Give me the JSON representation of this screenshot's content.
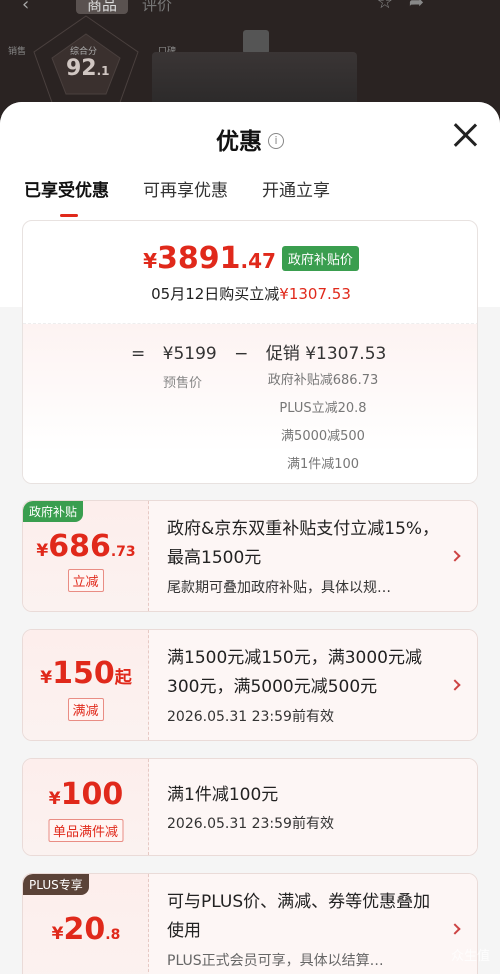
{
  "background": {
    "tab_active": "商品",
    "tab_next": "评价",
    "score_label": "综合分",
    "score_int": "92",
    "score_dec": ".1",
    "side_left": "销售",
    "side_right": "口碑"
  },
  "sheet": {
    "title": "优惠",
    "info_icon": "i",
    "tabs": [
      "已享受优惠",
      "可再享优惠",
      "开通立享"
    ]
  },
  "summary": {
    "currency": "¥",
    "price_int": "3891",
    "price_dec": ".47",
    "badge": "政府补贴价",
    "date_text": "05月12日购买立减",
    "date_amount": "¥1307.53",
    "formula_eq": "=",
    "formula_base": "¥5199",
    "formula_minus": "−",
    "formula_promo": "促销 ¥1307.53",
    "base_label": "预售价",
    "promo_items": [
      "政府补贴减686.73",
      "PLUS立减20.8",
      "满5000减500",
      "满1件减100"
    ]
  },
  "coupons": [
    {
      "corner": "政府补贴",
      "currency": "¥",
      "int": "686",
      "dec": ".73",
      "tag": "立减",
      "text": "政府&京东双重补贴支付立减15%，最高1500元",
      "sub": "尾款期可叠加政府补贴，具体以规…"
    },
    {
      "currency": "¥",
      "int": "150",
      "dec": "起",
      "tag": "满减",
      "text": "满1500元减150元，满3000元减300元，满5000元减500元",
      "sub": "2026.05.31 23:59前有效"
    },
    {
      "currency": "¥",
      "int": "100",
      "tag": "单品满件减",
      "text": "满1件减100元",
      "sub": "2026.05.31 23:59前有效"
    },
    {
      "corner": "PLUS专享",
      "currency": "¥",
      "int": "20",
      "dec": ".8",
      "text": "可与PLUS价、满减、券等优惠叠加使用",
      "sub": "PLUS正式会员可享，具体以结算…"
    }
  ],
  "watermark": "众生值",
  "colors": {
    "accent": "#e0291b",
    "gov_green": "#3a9e4f",
    "plus_brown": "#5b4338"
  }
}
